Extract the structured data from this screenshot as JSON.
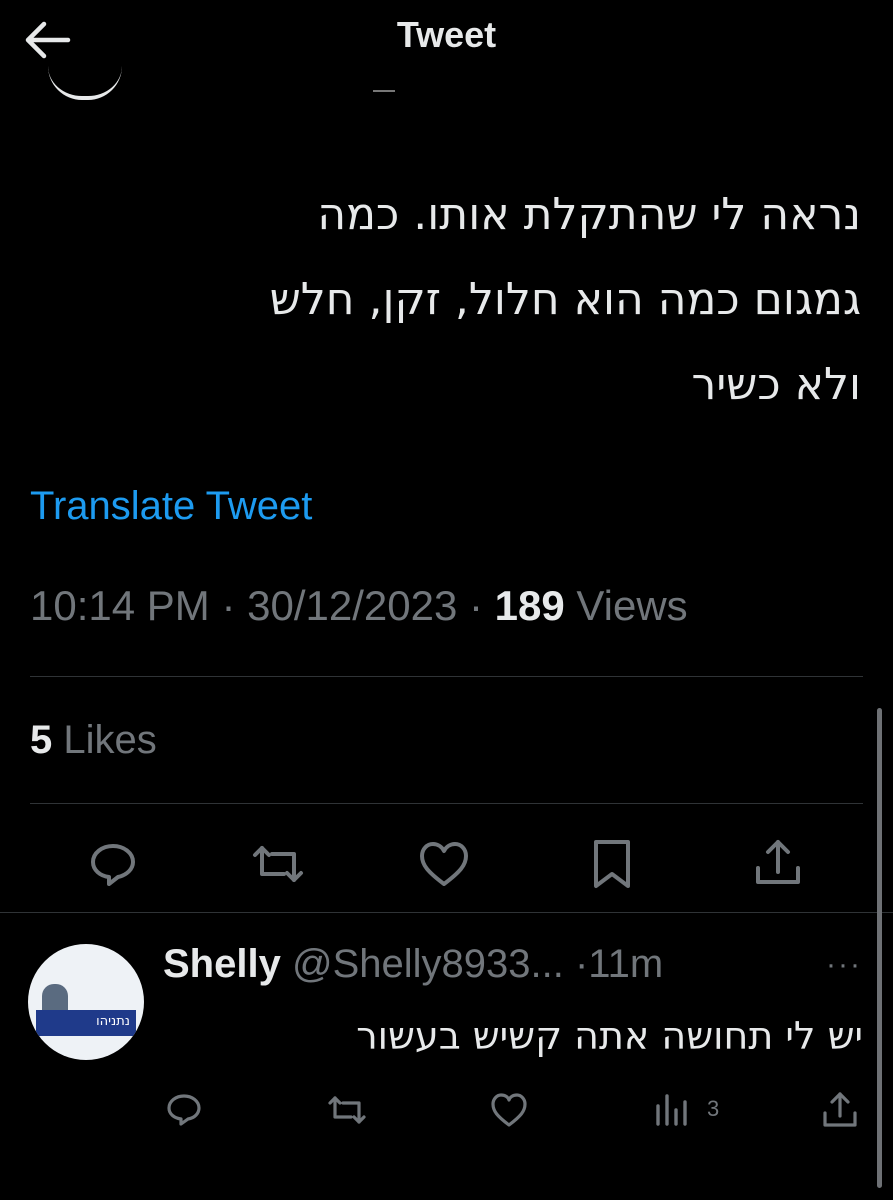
{
  "header": {
    "title": "Tweet"
  },
  "tweet": {
    "lines": [
      "נראה לי שהתקלת אותו. כמה",
      "גמגום  כמה הוא חלול, זקן, חלש",
      "ולא כשיר"
    ],
    "translate": "Translate Tweet",
    "time": "10:14 PM",
    "date": "30/12/2023",
    "views_count": "189",
    "views_label": "Views",
    "likes_count": "5",
    "likes_label": "Likes"
  },
  "reply": {
    "name": "Shelly",
    "handle": "@Shelly8933...",
    "age": "11m",
    "text": "יש לי תחושה אתה קשיש בעשור",
    "views": "3",
    "avatar_text": "נתניהו"
  },
  "colors": {
    "accent": "#1d9bf0",
    "muted": "#71767b",
    "text": "#e7e9ea"
  }
}
